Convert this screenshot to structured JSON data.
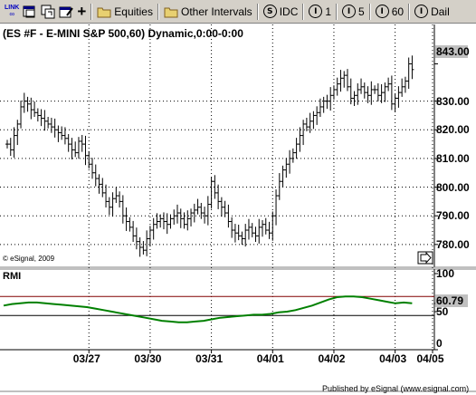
{
  "toolbar": {
    "link_label": "LINK",
    "equities_label": "Equities",
    "other_intervals_label": "Other Intervals",
    "symbol_btn": "S",
    "symbol_label": "IDC",
    "interval_btns": [
      {
        "icon": "I",
        "label": "1"
      },
      {
        "icon": "I",
        "label": "5"
      },
      {
        "icon": "I",
        "label": "60"
      },
      {
        "icon": "I",
        "label": "Dail"
      }
    ]
  },
  "chart": {
    "title": "(ES #F - E-MINI S&P 500,60) Dynamic,0:00-0:00",
    "copyright": "© eSignal, 2009",
    "published": "Published by eSignal (www.esignal.com)",
    "last_price": "843.00",
    "rmi_label": "RMI",
    "rmi_value": "60.79",
    "colors": {
      "bars": "#000000",
      "rmi_line": "#008000",
      "rmi_high_line": "#800000",
      "rmi_low_line": "#000000",
      "grid": "#000000",
      "value_box": "#c0c0c0"
    }
  },
  "chart_data": [
    {
      "type": "ohlc",
      "title": "(ES #F - E-MINI S&P 500,60) Dynamic,0:00-0:00",
      "ylim": [
        773,
        852
      ],
      "yticks": [
        "843.00",
        "830.00",
        "820.00",
        "810.00",
        "800.00",
        "790.00",
        "780.00"
      ],
      "xticks": [
        "03/27",
        "03/30",
        "03/31",
        "04/01",
        "04/02",
        "04/03",
        "04/05"
      ],
      "x_tick_bar_index": [
        24,
        42,
        60,
        78,
        96,
        114,
        125
      ],
      "closes": [
        815,
        813,
        818,
        822,
        828,
        830,
        829,
        827,
        826,
        825,
        824,
        823,
        822,
        821,
        820,
        819,
        818,
        817,
        815,
        813,
        812,
        816,
        815,
        811,
        808,
        805,
        803,
        801,
        798,
        795,
        793,
        796,
        797,
        795,
        790,
        788,
        786,
        783,
        781,
        779,
        778,
        782,
        785,
        787,
        788,
        789,
        788,
        787,
        789,
        790,
        791,
        789,
        787,
        789,
        791,
        792,
        793,
        791,
        790,
        794,
        802,
        798,
        795,
        793,
        791,
        788,
        785,
        784,
        783,
        782,
        785,
        786,
        784,
        783,
        786,
        787,
        785,
        784,
        790,
        797,
        802,
        806,
        808,
        810,
        812,
        815,
        818,
        822,
        821,
        823,
        825,
        826,
        828,
        830,
        830,
        832,
        834,
        836,
        838,
        839,
        835,
        831,
        832,
        834,
        835,
        833,
        832,
        834,
        834,
        832,
        833,
        835,
        836,
        829,
        831,
        833,
        835,
        837,
        843,
        841
      ],
      "last_price": 843.0
    },
    {
      "type": "line",
      "title": "RMI",
      "ylim": [
        0,
        100
      ],
      "yticks": [
        "100",
        "60.79",
        "50",
        "0"
      ],
      "series": [
        {
          "values": [
            58,
            60,
            61,
            62,
            62,
            61,
            60,
            59,
            58,
            57,
            56,
            54,
            52,
            50,
            48,
            46,
            44,
            42,
            40,
            38,
            37,
            36,
            36,
            37,
            38,
            40,
            42,
            43,
            44,
            45,
            46,
            46,
            47,
            49,
            50,
            52,
            55,
            58,
            62,
            66,
            69,
            70,
            70,
            69,
            67,
            65,
            63,
            61,
            62,
            61
          ]
        }
      ],
      "reference_lines": [
        70,
        45
      ]
    }
  ]
}
